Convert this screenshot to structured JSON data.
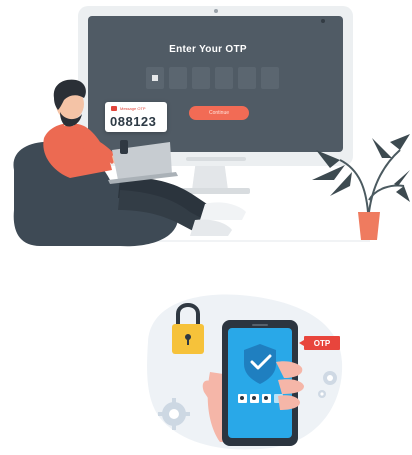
{
  "laptop_screen": {
    "title": "Enter Your OTP",
    "otp_digits": [
      "*",
      "",
      "",
      "",
      "",
      ""
    ],
    "submit_label": "Continue"
  },
  "message_card": {
    "sender_label": "Message OTP",
    "code": "088123"
  },
  "phone": {
    "badge_label": "OTP"
  },
  "colors": {
    "screen": "#505b65",
    "accent": "#f26b55",
    "badge": "#e8453c",
    "phone_screen": "#29a8e8",
    "shirt": "#ec6a52",
    "beanbag": "#3e4a55",
    "plant_pot": "#ef7b5f"
  }
}
